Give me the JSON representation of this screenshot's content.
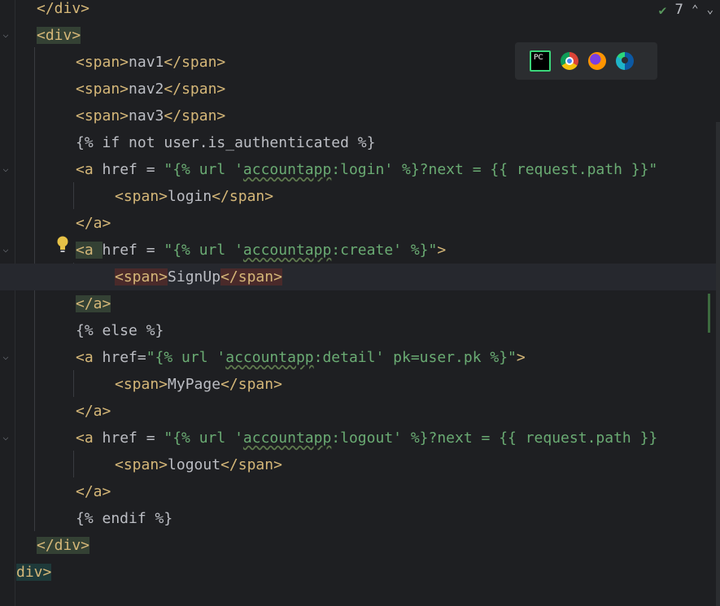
{
  "inspection": {
    "count": "7"
  },
  "lines": [
    {
      "tokens": [
        {
          "t": "</div>",
          "c": "tag"
        }
      ]
    },
    {
      "tokens": [
        {
          "t": "<div>",
          "c": "tag hl-green"
        }
      ]
    },
    {
      "tokens": [
        {
          "t": "<span>",
          "c": "tag"
        },
        {
          "t": "nav1",
          "c": "txt"
        },
        {
          "t": "</span>",
          "c": "tag"
        }
      ]
    },
    {
      "tokens": [
        {
          "t": "<span>",
          "c": "tag"
        },
        {
          "t": "nav2",
          "c": "txt"
        },
        {
          "t": "</span>",
          "c": "tag"
        }
      ]
    },
    {
      "tokens": [
        {
          "t": "<span>",
          "c": "tag"
        },
        {
          "t": "nav3",
          "c": "txt"
        },
        {
          "t": "</span>",
          "c": "tag"
        }
      ]
    },
    {
      "tokens": [
        {
          "t": "{% if not user.is_authenticated %}",
          "c": "tpl"
        }
      ]
    },
    {
      "tokens": [
        {
          "t": "<a ",
          "c": "tag"
        },
        {
          "t": "href = ",
          "c": "attr"
        },
        {
          "t": "\"{% url '",
          "c": "str"
        },
        {
          "t": "accountapp",
          "c": "str squig"
        },
        {
          "t": ":login' %}?next = {{ request.path }}\"",
          "c": "str"
        }
      ]
    },
    {
      "tokens": [
        {
          "t": "<span>",
          "c": "tag"
        },
        {
          "t": "login",
          "c": "txt"
        },
        {
          "t": "</span>",
          "c": "tag"
        }
      ]
    },
    {
      "tokens": [
        {
          "t": "</a>",
          "c": "tag"
        }
      ]
    },
    {
      "tokens": [
        {
          "t": "<a ",
          "c": "tag hl-green"
        },
        {
          "t": "href = ",
          "c": "attr"
        },
        {
          "t": "\"{% url '",
          "c": "str"
        },
        {
          "t": "accountapp",
          "c": "str squig"
        },
        {
          "t": ":create' %}\"",
          "c": "str"
        },
        {
          "t": ">",
          "c": "tag"
        }
      ]
    },
    {
      "tokens": [
        {
          "t": "<span>",
          "c": "tag hl-red"
        },
        {
          "t": "SignUp",
          "c": "txt"
        },
        {
          "t": "</span>",
          "c": "tag hl-red"
        }
      ]
    },
    {
      "tokens": [
        {
          "t": "</a>",
          "c": "tag hl-green"
        }
      ]
    },
    {
      "tokens": [
        {
          "t": "{% else %}",
          "c": "tpl"
        }
      ]
    },
    {
      "tokens": [
        {
          "t": "<a ",
          "c": "tag"
        },
        {
          "t": "href=",
          "c": "attr"
        },
        {
          "t": "\"{% url '",
          "c": "str"
        },
        {
          "t": "accountapp",
          "c": "str squig"
        },
        {
          "t": ":detail' pk=user.pk %}\"",
          "c": "str"
        },
        {
          "t": ">",
          "c": "tag"
        }
      ]
    },
    {
      "tokens": [
        {
          "t": "<span>",
          "c": "tag"
        },
        {
          "t": "MyPage",
          "c": "txt"
        },
        {
          "t": "</span>",
          "c": "tag"
        }
      ]
    },
    {
      "tokens": [
        {
          "t": "</a>",
          "c": "tag"
        }
      ]
    },
    {
      "tokens": [
        {
          "t": "<a ",
          "c": "tag"
        },
        {
          "t": "href = ",
          "c": "attr"
        },
        {
          "t": "\"{% url '",
          "c": "str"
        },
        {
          "t": "accountapp",
          "c": "str squig"
        },
        {
          "t": ":logout' %}?next = {{ request.path }}",
          "c": "str"
        }
      ]
    },
    {
      "tokens": [
        {
          "t": "<span>",
          "c": "tag"
        },
        {
          "t": "logout",
          "c": "txt"
        },
        {
          "t": "</span>",
          "c": "tag"
        }
      ]
    },
    {
      "tokens": [
        {
          "t": "</a>",
          "c": "tag"
        }
      ]
    },
    {
      "tokens": [
        {
          "t": "{% endif %}",
          "c": "tpl"
        }
      ]
    },
    {
      "tokens": [
        {
          "t": "</div>",
          "c": "tag hl-green"
        }
      ]
    },
    {
      "tokens": [
        {
          "t": "div>",
          "c": "tag hl-cyan"
        }
      ]
    }
  ],
  "browsers": [
    {
      "name": "pycharm-icon"
    },
    {
      "name": "chrome-icon"
    },
    {
      "name": "firefox-icon"
    },
    {
      "name": "edge-icon"
    }
  ]
}
